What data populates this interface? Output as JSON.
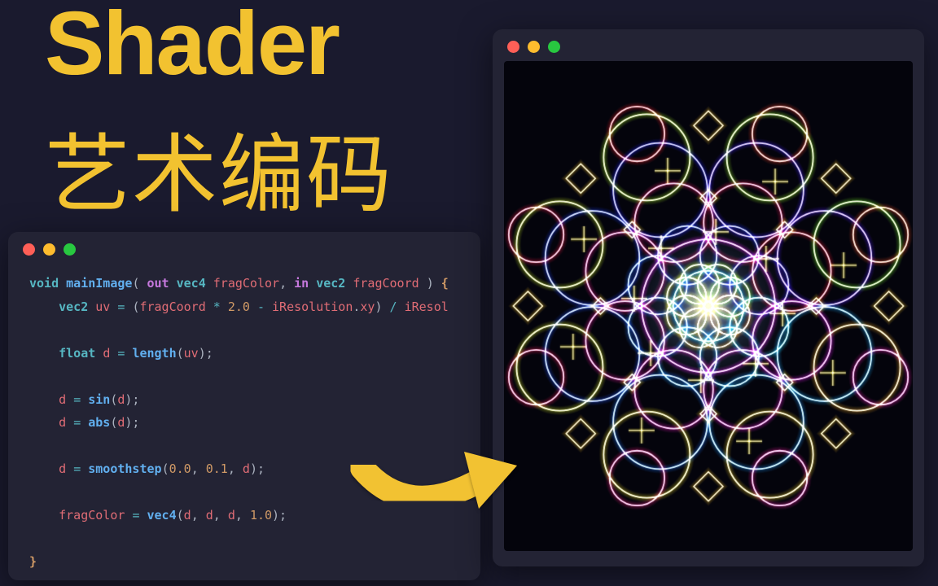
{
  "titles": {
    "en": "Shader",
    "cn": "艺术编码"
  },
  "colors": {
    "accent": "#f2c230",
    "bg": "#1a1a2e",
    "panel": "#232334"
  },
  "traffic_lights": [
    "red",
    "yellow",
    "green"
  ],
  "shader_code": {
    "signature": {
      "ret": "void",
      "name": "mainImage",
      "params": "out vec4 fragColor, in vec2 fragCoord"
    },
    "lines_display": [
      "void mainImage( out vec4 fragColor, in vec2 fragCoord ) {",
      "    vec2 uv = (fragCoord * 2.0 - iResolution.xy) / iResol",
      "",
      "    float d = length(uv);",
      "",
      "    d = sin(d);",
      "    d = abs(d);",
      "",
      "    d = smoothstep(0.0, 0.1, d);",
      "",
      "    fragColor = vec4(d, d, d, 1.0);",
      "",
      "}"
    ]
  },
  "output_label": "shader-output"
}
